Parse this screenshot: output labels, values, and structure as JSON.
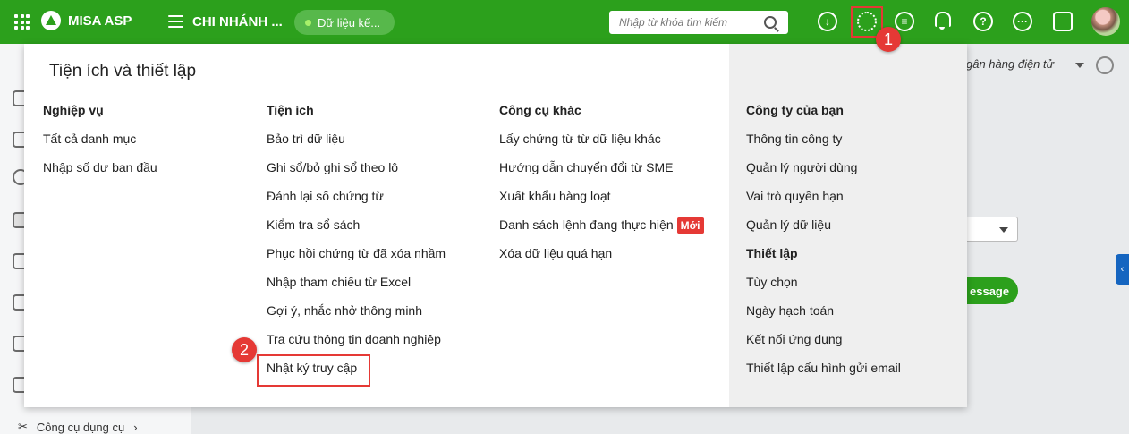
{
  "topbar": {
    "brand": "MISA ASP",
    "branch": "CHI NHÁNH ...",
    "data_status": "Dữ liệu kế...",
    "search_placeholder": "Nhập từ khóa tìm kiếm"
  },
  "background": {
    "bank_label": "gân hàng điện tử",
    "button_label": "essage",
    "sidebar_bottom_label": "Công cụ dụng cụ",
    "collapse_glyph": "‹"
  },
  "callouts": [
    "1",
    "2"
  ],
  "panel": {
    "title": "Tiện ích và thiết lập",
    "columns": [
      {
        "heading": "Nghiệp vụ",
        "items": [
          "Tất cả danh mục",
          "Nhập số dư ban đầu"
        ]
      },
      {
        "heading": "Tiện ích",
        "items": [
          "Bảo trì dữ liệu",
          "Ghi sổ/bỏ ghi sổ theo lô",
          "Đánh lại số chứng từ",
          "Kiểm tra sổ sách",
          "Phục hồi chứng từ đã xóa nhầm",
          "Nhập tham chiếu từ Excel",
          "Gợi ý, nhắc nhở thông minh",
          "Tra cứu thông tin doanh nghiệp",
          "Nhật ký truy cập"
        ]
      },
      {
        "heading": "Công cụ khác",
        "items": [
          "Lấy chứng từ từ dữ liệu khác",
          "Hướng dẫn chuyển đổi từ SME",
          "Xuất khẩu hàng loạt",
          "Danh sách lệnh đang thực hiện",
          "Xóa dữ liệu quá hạn"
        ],
        "new_tag": "Mới"
      },
      {
        "heading": "Công ty của bạn",
        "items": [
          "Thông tin công ty",
          "Quản lý người dùng",
          "Vai trò quyền hạn",
          "Quản lý dữ liệu"
        ],
        "heading2": "Thiết lập",
        "items2": [
          "Tùy chọn",
          "Ngày hạch toán",
          "Kết nối ứng dụng",
          "Thiết lập cấu hình gửi email"
        ]
      }
    ]
  },
  "colors": {
    "brand_green": "#2ca01c",
    "callout_red": "#e53935",
    "panel_right_bg": "#efefef"
  }
}
